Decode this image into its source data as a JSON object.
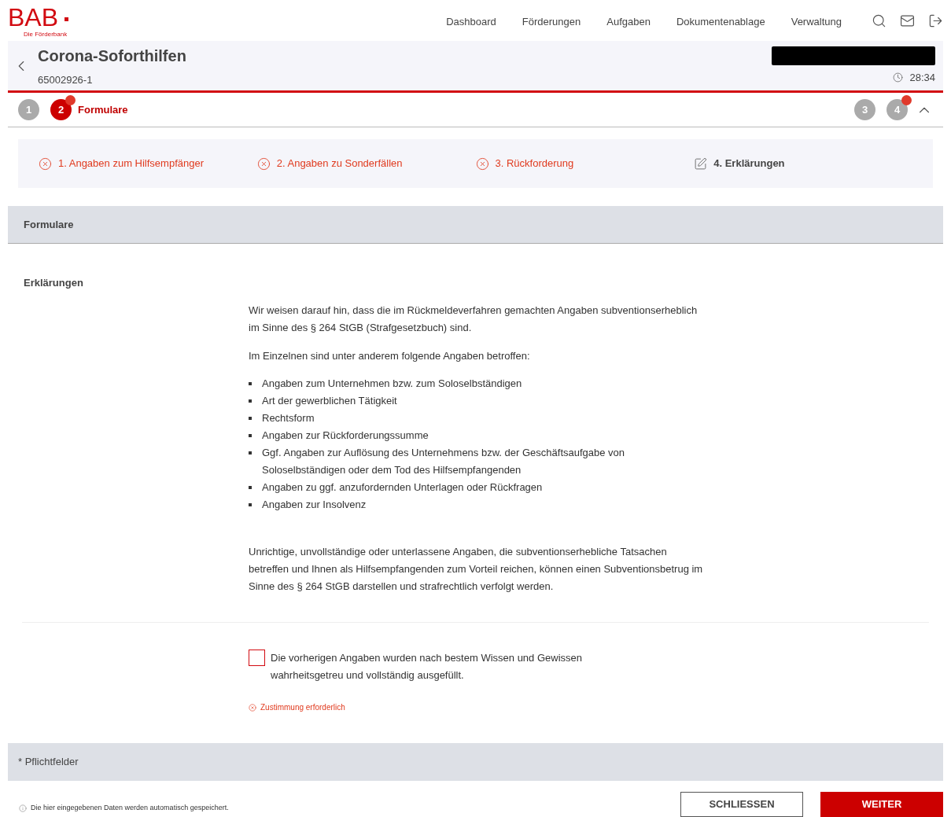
{
  "header": {
    "logo": "BAB",
    "logo_tagline": "Die Förderbank",
    "nav": [
      "Dashboard",
      "Förderungen",
      "Aufgaben",
      "Dokumentenablage",
      "Verwaltung"
    ]
  },
  "case": {
    "title": "Corona-Soforthilfen",
    "number": "65002926-1",
    "timer": "28:34"
  },
  "steps": [
    {
      "number": "1",
      "selected": false,
      "notice": false
    },
    {
      "number": "2",
      "label": "Formulare",
      "selected": true,
      "notice": true
    },
    {
      "number": "3",
      "selected": false,
      "notice": false
    },
    {
      "number": "4",
      "selected": false,
      "notice": true
    }
  ],
  "sections": [
    {
      "label": "1. Angaben zum Hilfsempfänger",
      "kind": "error"
    },
    {
      "label": "2. Angaben zu Sonderfällen",
      "kind": "error"
    },
    {
      "label": "3. Rückforderung",
      "kind": "error"
    },
    {
      "label": "4. Erklärungen",
      "kind": "edit"
    }
  ],
  "panel_title": "Formulare",
  "form": {
    "heading": "Erklärungen",
    "intro": "Wir weisen darauf hin, dass die im Rückmeldeverfahren gemachten Angaben subventionserheblich im Sinne des § 264 StGB (Strafgesetzbuch) sind.",
    "list_intro": "Im Einzelnen sind unter anderem folgende Angaben betroffen:",
    "items": [
      "Angaben zum Unternehmen bzw. zum Soloselbständigen",
      "Art der gewerblichen Tätigkeit",
      "Rechtsform",
      "Angaben zur Rückforderungssumme",
      "Ggf. Angaben zur Auflösung des Unternehmens bzw. der Geschäftsaufgabe von Soloselbständigen oder dem Tod des Hilfsempfangenden",
      "Angaben zu ggf. anzufordernden Unterlagen oder Rückfragen",
      "Angaben zur Insolvenz"
    ],
    "warning": "Unrichtige, unvollständige oder unterlassene Angaben, die subventionserhebliche Tatsachen betreffen und Ihnen als Hilfsempfangenden zum Vorteil reichen, können einen Subventionsbetrug im Sinne des § 264 StGB darstellen und strafrechtlich verfolgt werden.",
    "consent": {
      "label": "Die vorherigen Angaben wurden nach bestem Wissen und Gewissen wahrheitsgetreu und vollständig ausgefüllt.",
      "checked": false,
      "error": "Zustimmung erforderlich"
    }
  },
  "required_note": "* Pflichtfelder",
  "footer": {
    "autosave_note": "Die hier eingegebenen Daten werden automatisch gespeichert.",
    "buttons": [
      {
        "label": "SCHLIESSEN",
        "kind": "secondary"
      },
      {
        "label": "WEITER",
        "kind": "primary"
      }
    ]
  }
}
